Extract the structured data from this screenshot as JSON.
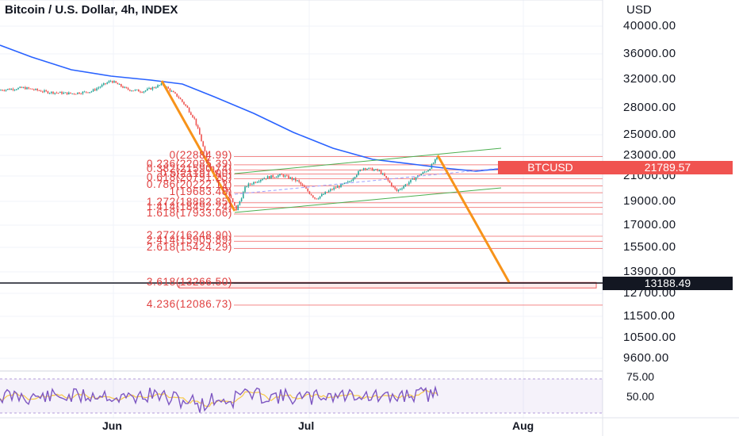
{
  "header": {
    "title": "Bitcoin / U.S. Dollar, 4h, INDEX",
    "currency": "USD"
  },
  "price_axis": {
    "ticks": [
      "40000.00",
      "36000.00",
      "32000.00",
      "28000.00",
      "25000.00",
      "23000.00",
      "21000.00",
      "19000.00",
      "17000.00",
      "15500.00",
      "13900.00",
      "12700.00",
      "11500.00",
      "10500.00",
      "9600.00"
    ]
  },
  "rsi_axis": {
    "ticks": [
      "75.00",
      "50.00"
    ]
  },
  "time_axis": {
    "ticks": [
      "Jun",
      "Jul",
      "Aug"
    ]
  },
  "fib_levels": [
    {
      "label": "0(22884.99)",
      "value": 22884.99
    },
    {
      "label": "0.236(22085.39)",
      "value": 22085.39
    },
    {
      "label": "0.382(21590.74)",
      "value": 21590.74
    },
    {
      "label": "0.5(21191.00)",
      "value": 21191.0
    },
    {
      "label": "0.618(20791.25)",
      "value": 20791.25
    },
    {
      "label": "0.786(20222.12)",
      "value": 20222.12
    },
    {
      "label": "1(19683.48)",
      "value": 19683.48
    },
    {
      "label": "1.272(18882.85)",
      "value": 18882.85
    },
    {
      "label": "1.414(18492.24)",
      "value": 18492.24
    },
    {
      "label": "1.618(17933.06)",
      "value": 17933.06
    },
    {
      "label": "2.272(16248.90)",
      "value": 16248.9
    },
    {
      "label": "2.414(15905.89)",
      "value": 15905.89
    },
    {
      "label": "2.618(15424.29)",
      "value": 15424.29
    },
    {
      "label": "3.618(13266.50)",
      "value": 13266.5
    },
    {
      "label": "4.236(12086.73)",
      "value": 12086.73
    }
  ],
  "badges": {
    "ticker": "BTCUSD",
    "last_price": "21789.57",
    "cursor_price": "13188.49"
  },
  "colors": {
    "up": "#26a69a",
    "down": "#ef5350",
    "ma": "#2962ff",
    "fib": "#f06060",
    "trend": "#f7931a",
    "channel": "#4caf50",
    "rsi": "#7e57c2",
    "rsi_ma": "#f7c948"
  },
  "chart_data": {
    "type": "candlestick",
    "series": [
      {
        "name": "BTCUSD",
        "kind": "candles"
      },
      {
        "kind": "moving-average",
        "values_approx": [
          [
            4,
            37000
          ],
          [
            180,
            32000
          ],
          [
            320,
            26500
          ],
          [
            430,
            23100
          ],
          [
            540,
            22000
          ],
          [
            690,
            22200
          ]
        ]
      },
      {
        "kind": "rsi"
      }
    ],
    "projection_target": 13266.5
  }
}
